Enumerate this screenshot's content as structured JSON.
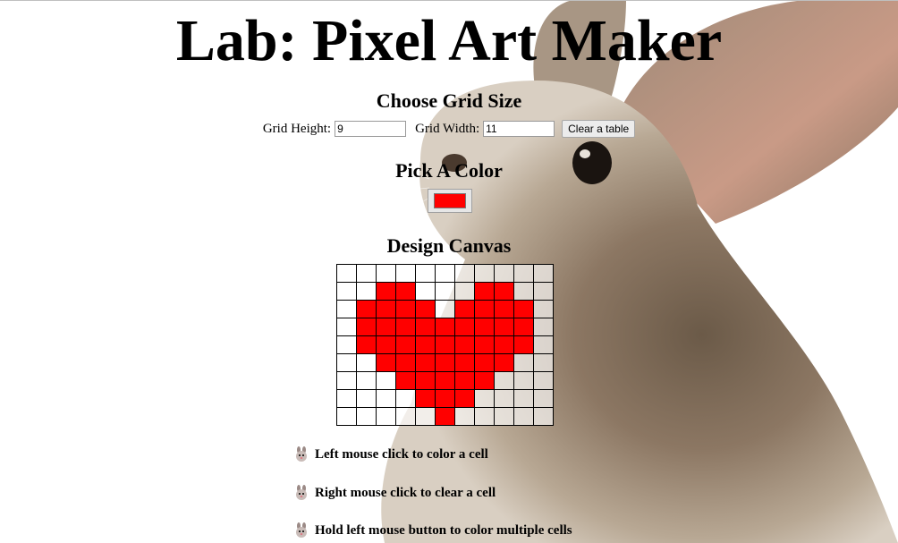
{
  "page": {
    "title": "Lab: Pixel Art Maker"
  },
  "grid_size": {
    "heading": "Choose Grid Size",
    "height_label": "Grid Height:",
    "height_value": "9",
    "width_label": "Grid Width:",
    "width_value": "11",
    "clear_button_label": "Clear a table"
  },
  "color": {
    "heading": "Pick A Color",
    "selected_color": "#ff0000"
  },
  "canvas": {
    "heading": "Design Canvas",
    "rows": 9,
    "cols": 11,
    "paint_color": "#ff0000",
    "filled_cells": [
      [],
      [
        2,
        3,
        7,
        8
      ],
      [
        1,
        2,
        3,
        4,
        6,
        7,
        8,
        9
      ],
      [
        1,
        2,
        3,
        4,
        5,
        6,
        7,
        8,
        9
      ],
      [
        1,
        2,
        3,
        4,
        5,
        6,
        7,
        8,
        9
      ],
      [
        2,
        3,
        4,
        5,
        6,
        7,
        8
      ],
      [
        3,
        4,
        5,
        6,
        7
      ],
      [
        4,
        5,
        6
      ],
      [
        5
      ]
    ]
  },
  "hints": [
    {
      "icon": "bunny-icon",
      "text": "Left mouse click to color a cell"
    },
    {
      "icon": "bunny-icon",
      "text": "Right mouse click to clear a cell"
    },
    {
      "icon": "bunny-icon",
      "text": "Hold left mouse button to color multiple cells"
    }
  ]
}
